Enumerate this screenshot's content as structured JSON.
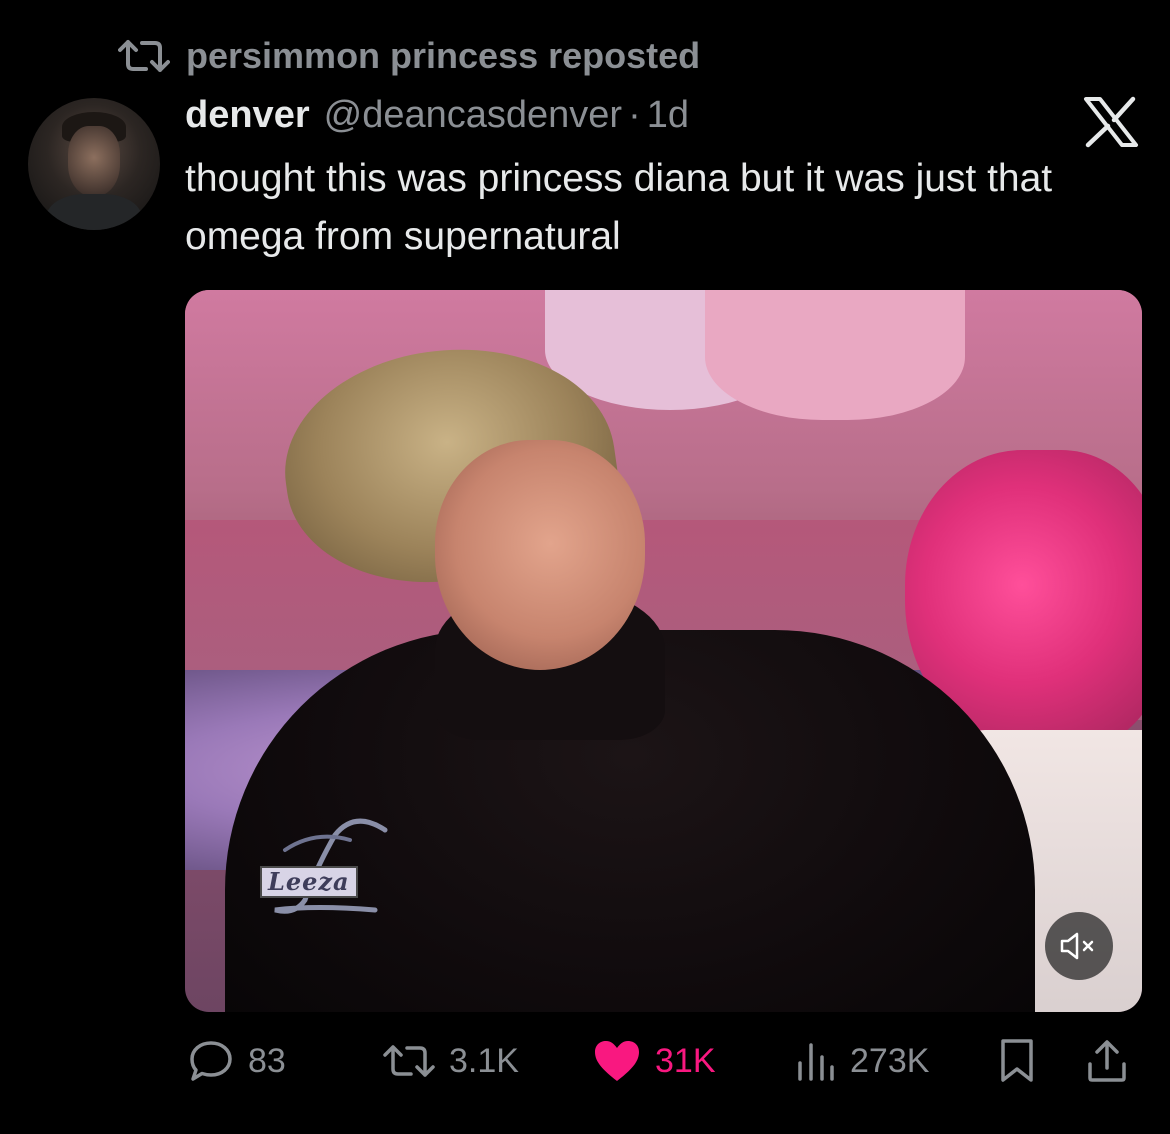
{
  "repost": {
    "label": "persimmon princess reposted",
    "icon": "repost-icon"
  },
  "tweet": {
    "display_name": "denver",
    "handle": "@deancasdenver",
    "separator": "·",
    "age": "1d",
    "text": "thought this was princess diana but it was just that omega from supernatural",
    "platform_icon": "x-logo-icon"
  },
  "media": {
    "type": "video",
    "overlay_text": "Leeza",
    "mute_icon": "speaker-muted-icon"
  },
  "actions": {
    "replies": "83",
    "reposts": "3.1K",
    "likes": "31K",
    "views": "273K",
    "liked": true
  },
  "colors": {
    "background": "#000000",
    "text_primary": "#e7e9ea",
    "text_secondary": "#8b8f94",
    "like_accent": "#f91880"
  }
}
